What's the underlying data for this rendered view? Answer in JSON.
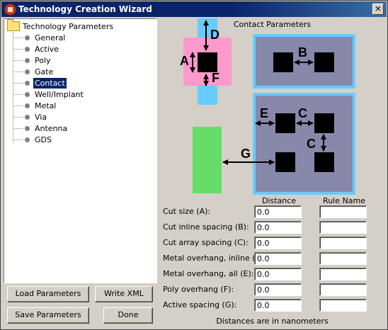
{
  "window": {
    "title": "Technology Creation Wizard",
    "close_glyph": "✕"
  },
  "tree": {
    "root_label": "Technology Parameters",
    "items": [
      {
        "label": "General"
      },
      {
        "label": "Active"
      },
      {
        "label": "Poly"
      },
      {
        "label": "Gate"
      },
      {
        "label": "Contact",
        "selected": true
      },
      {
        "label": "Well/Implant"
      },
      {
        "label": "Metal"
      },
      {
        "label": "Via"
      },
      {
        "label": "Antenna"
      },
      {
        "label": "GDS"
      }
    ]
  },
  "buttons": {
    "load": "Load Parameters",
    "write_xml": "Write XML",
    "save": "Save Parameters",
    "done": "Done"
  },
  "panel": {
    "title": "Contact Parameters",
    "diagram_labels": {
      "a": "A",
      "b": "B",
      "c": "C",
      "c2": "C",
      "d": "D",
      "e": "E",
      "f": "F",
      "g": "G"
    },
    "col_distance": "Distance",
    "col_rule": "Rule Name",
    "rows": [
      {
        "label": "Cut size (A):",
        "distance": "0.0",
        "rule": ""
      },
      {
        "label": "Cut inline spacing (B):",
        "distance": "0.0",
        "rule": ""
      },
      {
        "label": "Cut array spacing (C):",
        "distance": "0.0",
        "rule": ""
      },
      {
        "label": "Metal overhang, inline (D):",
        "distance": "0.0",
        "rule": ""
      },
      {
        "label": "Metal overhang, all (E):",
        "distance": "0.0",
        "rule": ""
      },
      {
        "label": "Poly overhang (F):",
        "distance": "0.0",
        "rule": ""
      },
      {
        "label": "Active spacing (G):",
        "distance": "0.0",
        "rule": ""
      }
    ],
    "footer": "Distances are in nanometers"
  },
  "colors": {
    "metal_pink": "#ff99cc",
    "poly_cyan": "#66ccff",
    "active_green": "#66dd66",
    "well_gray": "#8888aa",
    "selection": "#0a246a"
  }
}
